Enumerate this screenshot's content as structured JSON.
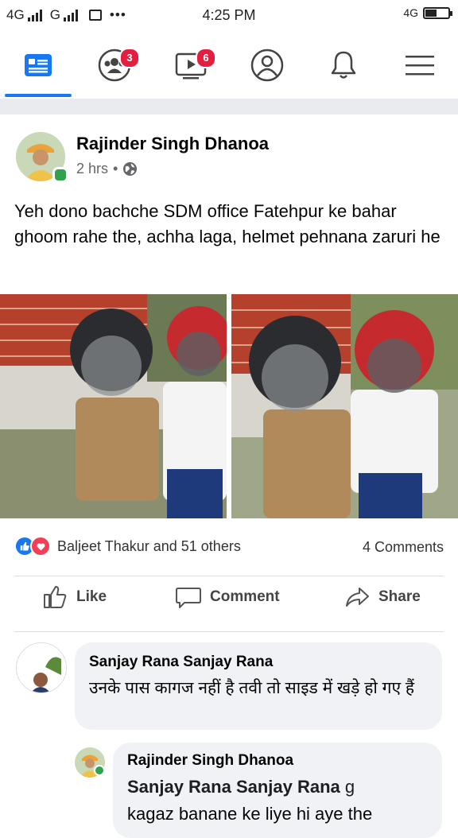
{
  "status_bar": {
    "network_left": "4G",
    "network_mid": "G",
    "time": "4:25 PM",
    "network_right": "4G"
  },
  "nav": {
    "items": [
      {
        "name": "news-feed",
        "icon": "news-feed-icon"
      },
      {
        "name": "groups",
        "icon": "groups-icon",
        "badge": "3"
      },
      {
        "name": "watch",
        "icon": "video-icon",
        "badge": "6"
      },
      {
        "name": "profile",
        "icon": "profile-icon"
      },
      {
        "name": "notifications",
        "icon": "bell-icon"
      },
      {
        "name": "menu",
        "icon": "hamburger-icon"
      }
    ],
    "active_index": 0
  },
  "post": {
    "author": "Rajinder Singh Dhanoa",
    "time": "2 hrs",
    "separator": "•",
    "privacy_icon": "globe-icon",
    "text": "Yeh dono bachche SDM office Fatehpur ke bahar ghoom rahe the, achha laga, helmet pehnana zaruri he",
    "reactions_text": "Baljeet Thakur and 51 others",
    "comments_count": "4 Comments",
    "actions": {
      "like": "Like",
      "comment": "Comment",
      "share": "Share"
    }
  },
  "comments": [
    {
      "author": "Sanjay Rana Sanjay Rana",
      "text": "उनके पास कागज नहीं है तवी तो साइड में खड़े हो गए हैं"
    },
    {
      "author": "Rajinder Singh Dhanoa",
      "mention": "Sanjay Rana Sanjay Rana",
      "mention_suffix": "g",
      "text": "kagaz banane ke liye hi aye the"
    }
  ],
  "colors": {
    "accent": "#1877f2",
    "badge": "#e41e3f",
    "love": "#f33e58",
    "online": "#31a24c"
  }
}
